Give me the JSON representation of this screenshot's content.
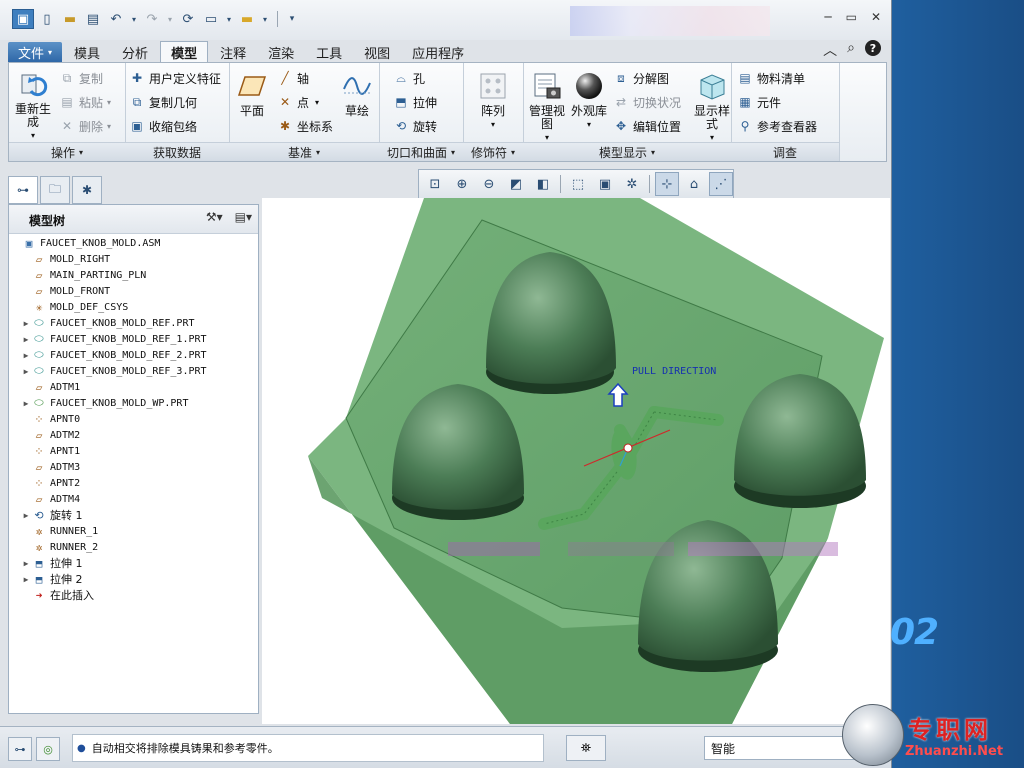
{
  "quick_access": {
    "icons": [
      "app-logo-icon",
      "new-icon",
      "open-icon",
      "save-icon",
      "undo-icon",
      "redo-icon",
      "regenerate-icon",
      "windows-icon",
      "folder-icon",
      "customize-icon"
    ]
  },
  "window_controls": {
    "minimize": "─",
    "restore": "▭",
    "close": "✕"
  },
  "tabs": [
    {
      "label": "文件"
    },
    {
      "label": "模具"
    },
    {
      "label": "分析"
    },
    {
      "label": "模型"
    },
    {
      "label": "注释"
    },
    {
      "label": "渲染"
    },
    {
      "label": "工具"
    },
    {
      "label": "视图"
    },
    {
      "label": "应用程序"
    }
  ],
  "ribbon": {
    "operations": {
      "regenerate": "重新生成",
      "copy": "复制",
      "paste": "粘贴",
      "delete": "删除",
      "label": "操作"
    },
    "get_data": {
      "udf": "用户定义特征",
      "copy_geom": "复制几何",
      "shrinkwrap": "收缩包络",
      "label": "获取数据"
    },
    "datum": {
      "plane": "平面",
      "axis": "轴",
      "point": "点",
      "csys": "坐标系",
      "sketch": "草绘",
      "label": "基准"
    },
    "cut_surface": {
      "hole": "孔",
      "extrude": "拉伸",
      "revolve": "旋转",
      "label": "切口和曲面"
    },
    "modifiers": {
      "pattern": "阵列",
      "label": "修饰符"
    },
    "model_display": {
      "manage_views": "管理视图",
      "appearance": "外观库",
      "explode": "分解图",
      "toggle_status": "切换状况",
      "edit_position": "编辑位置",
      "display_style": "显示样式",
      "label": "模型显示"
    },
    "investigate": {
      "bom": "物料清单",
      "component": "元件",
      "ref_viewer": "参考查看器",
      "label": "调查"
    }
  },
  "model_tree": {
    "title": "模型树",
    "items": [
      {
        "label": "FAUCET_KNOB_MOLD.ASM",
        "icon": "assembly-icon",
        "expand": false,
        "indent": 0
      },
      {
        "label": "MOLD_RIGHT",
        "icon": "datum-plane-icon",
        "expand": false,
        "indent": 1
      },
      {
        "label": "MAIN_PARTING_PLN",
        "icon": "datum-plane-icon",
        "expand": false,
        "indent": 1
      },
      {
        "label": "MOLD_FRONT",
        "icon": "datum-plane-icon",
        "expand": false,
        "indent": 1
      },
      {
        "label": "MOLD_DEF_CSYS",
        "icon": "csys-icon",
        "expand": false,
        "indent": 1
      },
      {
        "label": "FAUCET_KNOB_MOLD_REF.PRT",
        "icon": "part-icon",
        "expand": true,
        "indent": 1
      },
      {
        "label": "FAUCET_KNOB_MOLD_REF_1.PRT",
        "icon": "part-icon",
        "expand": true,
        "indent": 1
      },
      {
        "label": "FAUCET_KNOB_MOLD_REF_2.PRT",
        "icon": "part-icon",
        "expand": true,
        "indent": 1
      },
      {
        "label": "FAUCET_KNOB_MOLD_REF_3.PRT",
        "icon": "part-icon",
        "expand": true,
        "indent": 1
      },
      {
        "label": "ADTM1",
        "icon": "datum-plane-icon",
        "expand": false,
        "indent": 1
      },
      {
        "label": "FAUCET_KNOB_MOLD_WP.PRT",
        "icon": "workpiece-icon",
        "expand": true,
        "indent": 1
      },
      {
        "label": "APNT0",
        "icon": "datum-point-icon",
        "expand": false,
        "indent": 1
      },
      {
        "label": "ADTM2",
        "icon": "datum-plane-icon",
        "expand": false,
        "indent": 1
      },
      {
        "label": "APNT1",
        "icon": "datum-point-icon",
        "expand": false,
        "indent": 1
      },
      {
        "label": "ADTM3",
        "icon": "datum-plane-icon",
        "expand": false,
        "indent": 1
      },
      {
        "label": "APNT2",
        "icon": "datum-point-icon",
        "expand": false,
        "indent": 1
      },
      {
        "label": "ADTM4",
        "icon": "datum-plane-icon",
        "expand": false,
        "indent": 1
      },
      {
        "label": "旋转 1",
        "icon": "revolve-icon",
        "expand": true,
        "indent": 1
      },
      {
        "label": "RUNNER_1",
        "icon": "runner-icon",
        "expand": false,
        "indent": 1
      },
      {
        "label": "RUNNER_2",
        "icon": "runner-icon",
        "expand": false,
        "indent": 1
      },
      {
        "label": "拉伸 1",
        "icon": "extrude-icon",
        "expand": true,
        "indent": 1
      },
      {
        "label": "拉伸 2",
        "icon": "extrude-icon",
        "expand": true,
        "indent": 1
      },
      {
        "label": "在此插入",
        "icon": "insert-here-icon",
        "expand": false,
        "indent": 1
      }
    ]
  },
  "viewport": {
    "pull_direction": "PULL DIRECTION"
  },
  "status": {
    "message": "自动相交将排除模具铸果和参考零件。",
    "filter": "智能"
  },
  "decoration": {
    "number": "02",
    "brand": "专职网",
    "brand_url": "Zhuanzhi.Net"
  }
}
